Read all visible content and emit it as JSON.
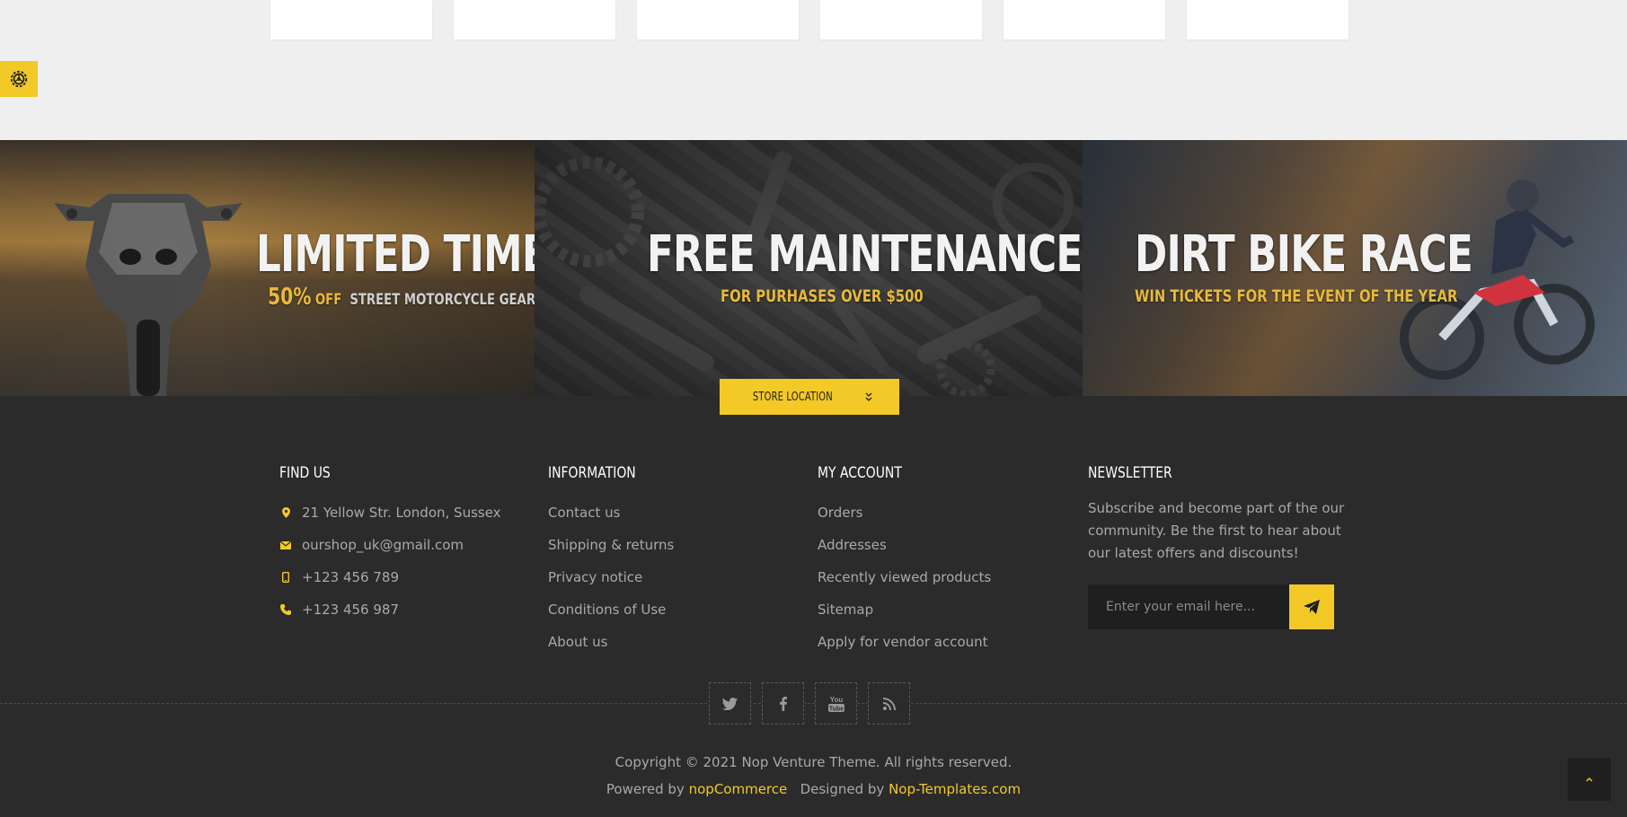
{
  "banners": [
    {
      "title": "LIMITED TIME!",
      "subtitle_strong": "50%",
      "subtitle_off": "OFF",
      "subtitle_rest": "STREET MOTORCYCLE GEAR"
    },
    {
      "title": "FREE MAINTENANCE",
      "subtitle": "FOR PURHASES OVER $500"
    },
    {
      "title": "DIRT BIKE RACE",
      "subtitle": "WIN TICKETS FOR THE EVENT OF THE YEAR"
    }
  ],
  "store_location": {
    "label": "STORE LOCATION",
    "icon": "double-chevron-down-icon"
  },
  "find_us": {
    "title": "FIND US",
    "items": [
      {
        "icon": "map-pin-icon",
        "text": "21 Yellow Str. London, Sussex"
      },
      {
        "icon": "envelope-icon",
        "text": "ourshop_uk@gmail.com"
      },
      {
        "icon": "mobile-phone-icon",
        "text": "+123 456 789"
      },
      {
        "icon": "phone-icon",
        "text": "+123 456 987"
      }
    ]
  },
  "information": {
    "title": "INFORMATION",
    "links": [
      "Contact us",
      "Shipping & returns",
      "Privacy notice",
      "Conditions of Use",
      "About us"
    ]
  },
  "my_account": {
    "title": "MY ACCOUNT",
    "links": [
      "Orders",
      "Addresses",
      "Recently viewed products",
      "Sitemap",
      "Apply for vendor account"
    ]
  },
  "newsletter": {
    "title": "NEWSLETTER",
    "text": "Subscribe and become part of the our community. Be the first to hear about our latest offers and discounts!",
    "placeholder": "Enter your email here...",
    "submit_icon": "paper-plane-icon"
  },
  "social": [
    "twitter-icon",
    "facebook-icon",
    "youtube-icon",
    "rss-icon"
  ],
  "copyright": "Copyright © 2021 Nop Venture Theme. All rights reserved.",
  "powered": {
    "prefix": "Powered by",
    "link1": "nopCommerce",
    "middle": "Designed by",
    "link2": "Nop-Templates.com"
  },
  "colors": {
    "accent": "#f3c927",
    "footer_bg": "#2b2b2b",
    "top_bg": "#efefef"
  }
}
